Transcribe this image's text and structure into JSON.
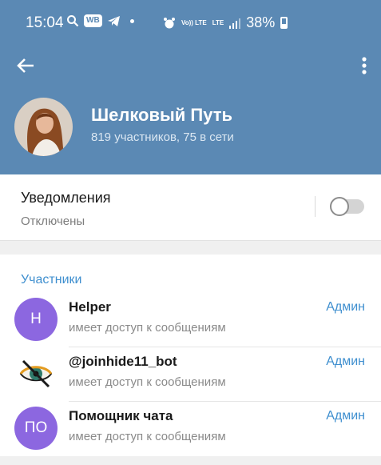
{
  "status_bar": {
    "time": "15:04",
    "wb_badge": "WB",
    "net_label_top": "Vo)) LTE",
    "net_label_2": "LTE",
    "battery": "38%"
  },
  "header": {
    "title": "Шелковый Путь",
    "subtitle": "819 участников, 75 в сети"
  },
  "notifications": {
    "title": "Уведомления",
    "value": "Отключены",
    "enabled": false
  },
  "members_section": {
    "title": "Участники",
    "items": [
      {
        "initials": "H",
        "name": "Helper",
        "status": "имеет доступ к сообщениям",
        "role": "Админ",
        "avatar_color": "#8c67e0"
      },
      {
        "initials": "",
        "name": "@joinhide11_bot",
        "status": "имеет доступ к сообщениям",
        "role": "Админ",
        "avatar_icon": "eye-crossed-icon"
      },
      {
        "initials": "ПО",
        "name": "Помощник чата",
        "status": "имеет доступ к сообщениям",
        "role": "Админ",
        "avatar_color": "#8c67e0"
      }
    ]
  },
  "colors": {
    "header_bg": "#5b89b4",
    "accent": "#3f8fcf",
    "avatar_purple": "#8c67e0"
  }
}
